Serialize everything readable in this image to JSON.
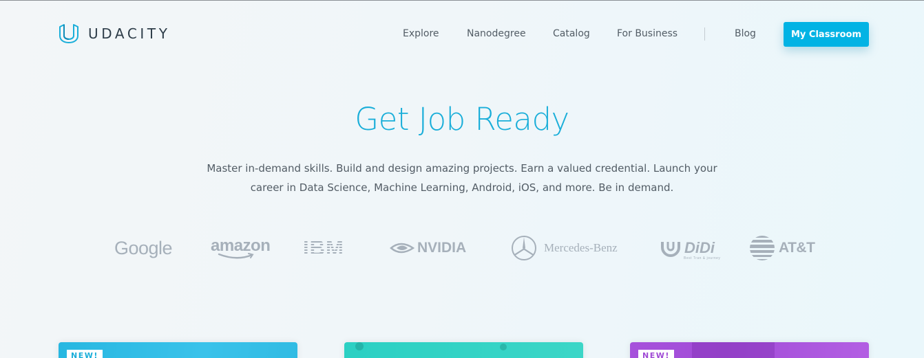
{
  "brand": {
    "name": "UDACITY"
  },
  "nav": {
    "items": [
      {
        "label": "Explore"
      },
      {
        "label": "Nanodegree"
      },
      {
        "label": "Catalog"
      },
      {
        "label": "For Business"
      },
      {
        "label": "Blog"
      }
    ],
    "cta_label": "My Classroom"
  },
  "hero": {
    "title": "Get Job Ready",
    "subtitle_line1": "Master in-demand skills. Build and design amazing projects. Earn a valued credential. Launch your",
    "subtitle_line2": "career in Data Science, Machine Learning, Android, iOS, and more. Be in demand."
  },
  "partners": [
    {
      "name": "Google",
      "label": "Google"
    },
    {
      "name": "Amazon",
      "label": "amazon"
    },
    {
      "name": "IBM",
      "label": "IBM"
    },
    {
      "name": "NVIDIA",
      "label": "NVIDIA"
    },
    {
      "name": "Mercedes-Benz",
      "label": "Mercedes-Benz"
    },
    {
      "name": "DiDi",
      "label": "DiDi",
      "tagline": "Best Tran & journey"
    },
    {
      "name": "AT&T",
      "label": "AT&T"
    }
  ],
  "cards": [
    {
      "badge": "NEW!",
      "color": "#30bbe3"
    },
    {
      "badge": "",
      "color": "#3cd6c7"
    },
    {
      "badge": "NEW!",
      "color": "#a651db"
    }
  ],
  "colors": {
    "accent": "#02b3e4",
    "title": "#1aaed9",
    "logo_gray": "#a6b0ba"
  }
}
